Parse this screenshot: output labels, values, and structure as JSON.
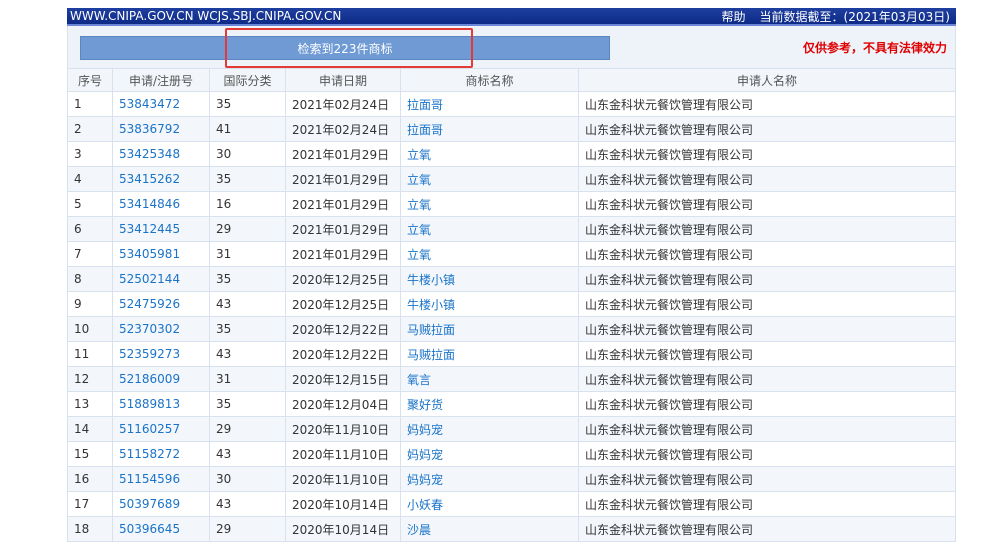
{
  "topbar": {
    "domains": "WWW.CNIPA.GOV.CN WCJS.SBJ.CNIPA.GOV.CN",
    "help": "帮助",
    "data_date": "当前数据截至：(2021年03月03日)"
  },
  "search": {
    "result_label": "检索到223件商标",
    "disclaimer": "仅供参考，不具有法律效力"
  },
  "table": {
    "headers": [
      "序号",
      "申请/注册号",
      "国际分类",
      "申请日期",
      "商标名称",
      "申请人名称"
    ],
    "rows": [
      {
        "idx": "1",
        "reg": "53843472",
        "cls": "35",
        "date": "2021年02月24日",
        "name": "拉面哥",
        "applicant": "山东金科状元餐饮管理有限公司"
      },
      {
        "idx": "2",
        "reg": "53836792",
        "cls": "41",
        "date": "2021年02月24日",
        "name": "拉面哥",
        "applicant": "山东金科状元餐饮管理有限公司"
      },
      {
        "idx": "3",
        "reg": "53425348",
        "cls": "30",
        "date": "2021年01月29日",
        "name": "立氧",
        "applicant": "山东金科状元餐饮管理有限公司"
      },
      {
        "idx": "4",
        "reg": "53415262",
        "cls": "35",
        "date": "2021年01月29日",
        "name": "立氧",
        "applicant": "山东金科状元餐饮管理有限公司"
      },
      {
        "idx": "5",
        "reg": "53414846",
        "cls": "16",
        "date": "2021年01月29日",
        "name": "立氧",
        "applicant": "山东金科状元餐饮管理有限公司"
      },
      {
        "idx": "6",
        "reg": "53412445",
        "cls": "29",
        "date": "2021年01月29日",
        "name": "立氧",
        "applicant": "山东金科状元餐饮管理有限公司"
      },
      {
        "idx": "7",
        "reg": "53405981",
        "cls": "31",
        "date": "2021年01月29日",
        "name": "立氧",
        "applicant": "山东金科状元餐饮管理有限公司"
      },
      {
        "idx": "8",
        "reg": "52502144",
        "cls": "35",
        "date": "2020年12月25日",
        "name": "牛楼小镇",
        "applicant": "山东金科状元餐饮管理有限公司"
      },
      {
        "idx": "9",
        "reg": "52475926",
        "cls": "43",
        "date": "2020年12月25日",
        "name": "牛楼小镇",
        "applicant": "山东金科状元餐饮管理有限公司"
      },
      {
        "idx": "10",
        "reg": "52370302",
        "cls": "35",
        "date": "2020年12月22日",
        "name": "马贼拉面",
        "applicant": "山东金科状元餐饮管理有限公司"
      },
      {
        "idx": "11",
        "reg": "52359273",
        "cls": "43",
        "date": "2020年12月22日",
        "name": "马贼拉面",
        "applicant": "山东金科状元餐饮管理有限公司"
      },
      {
        "idx": "12",
        "reg": "52186009",
        "cls": "31",
        "date": "2020年12月15日",
        "name": "氧言",
        "applicant": "山东金科状元餐饮管理有限公司"
      },
      {
        "idx": "13",
        "reg": "51889813",
        "cls": "35",
        "date": "2020年12月04日",
        "name": "聚好货",
        "applicant": "山东金科状元餐饮管理有限公司"
      },
      {
        "idx": "14",
        "reg": "51160257",
        "cls": "29",
        "date": "2020年11月10日",
        "name": "妈妈宠",
        "applicant": "山东金科状元餐饮管理有限公司"
      },
      {
        "idx": "15",
        "reg": "51158272",
        "cls": "43",
        "date": "2020年11月10日",
        "name": "妈妈宠",
        "applicant": "山东金科状元餐饮管理有限公司"
      },
      {
        "idx": "16",
        "reg": "51154596",
        "cls": "30",
        "date": "2020年11月10日",
        "name": "妈妈宠",
        "applicant": "山东金科状元餐饮管理有限公司"
      },
      {
        "idx": "17",
        "reg": "50397689",
        "cls": "43",
        "date": "2020年10月14日",
        "name": "小妖春",
        "applicant": "山东金科状元餐饮管理有限公司"
      },
      {
        "idx": "18",
        "reg": "50396645",
        "cls": "29",
        "date": "2020年10月14日",
        "name": "沙晨",
        "applicant": "山东金科状元餐饮管理有限公司"
      }
    ]
  },
  "colors": {
    "topbar": "#0d2a86",
    "result_button": "#6f9ad4",
    "highlight_box": "#e53935",
    "disclaimer": "#e00000",
    "link": "#1a73c8"
  }
}
